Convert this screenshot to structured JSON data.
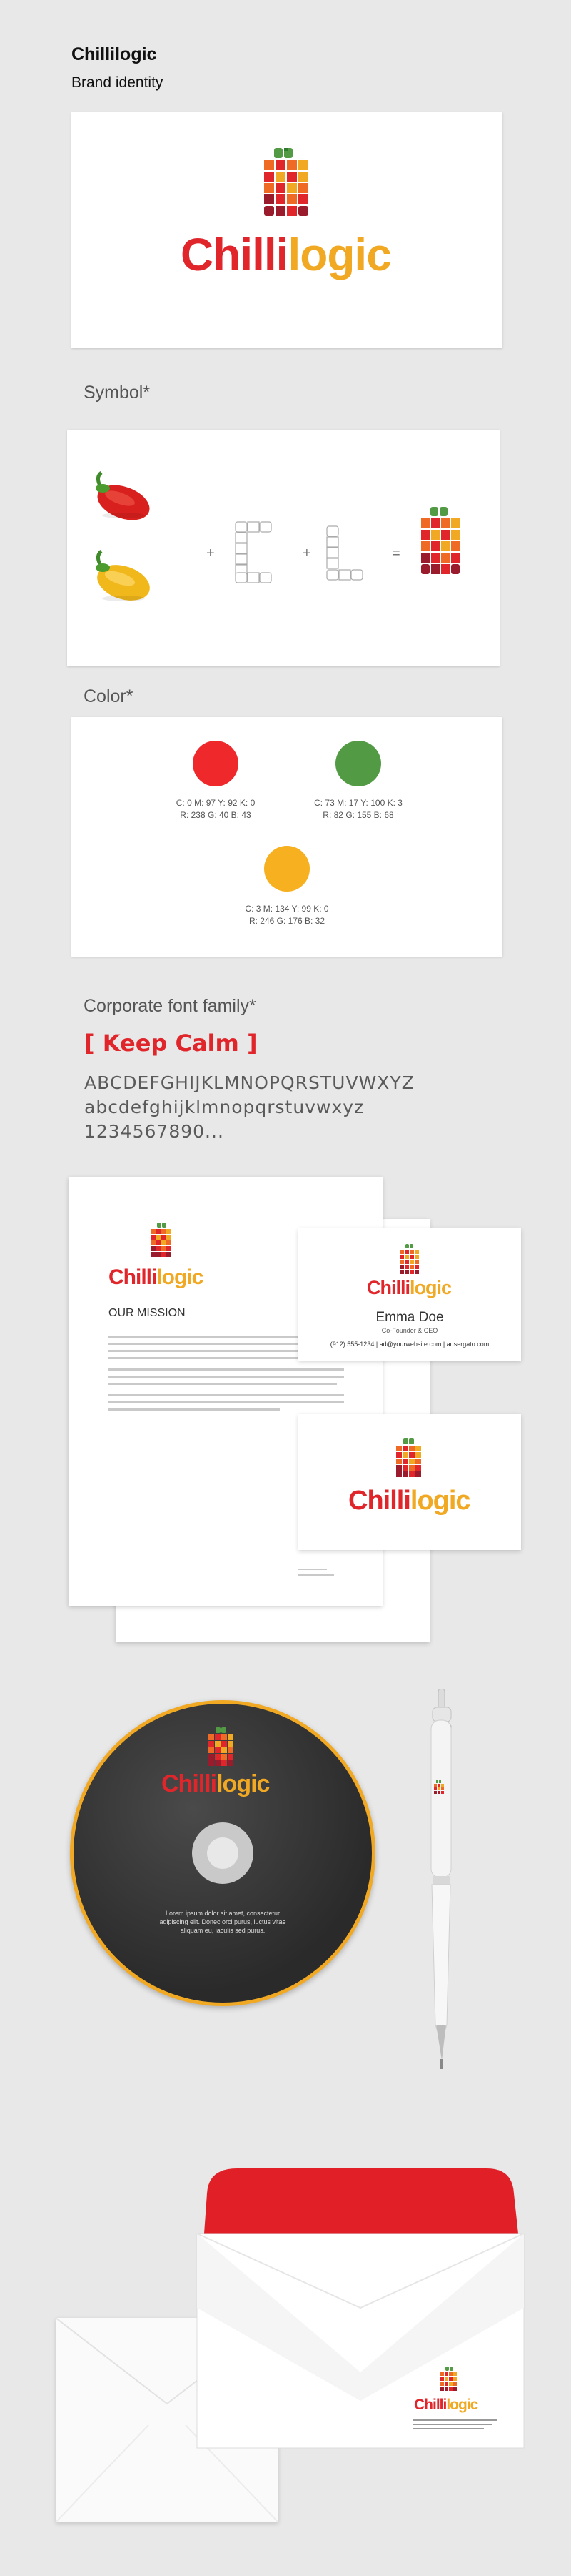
{
  "header": {
    "title": "Chillilogic",
    "subtitle": "Brand identity"
  },
  "logo": {
    "word_part1": "Chilli",
    "word_part2": "logic"
  },
  "symbol": {
    "heading": "Symbol*",
    "plus1": "+",
    "plus2": "+",
    "equals": "="
  },
  "color": {
    "heading": "Color*",
    "swatches": [
      {
        "hex": "#ee282b",
        "cmyk": "C: 0 M: 97 Y: 92 K: 0",
        "rgb": "R: 238 G: 40 B: 43"
      },
      {
        "hex": "#529b44",
        "cmyk": "C: 73 M: 17 Y: 100 K: 3",
        "rgb": "R: 82 G: 155 B: 68"
      },
      {
        "hex": "#f6b020",
        "cmyk": "C: 3 M: 134 Y: 99 K: 0",
        "rgb": "R: 246 G: 176 B: 32"
      }
    ]
  },
  "font": {
    "heading": "Corporate font family*",
    "name": "[ Keep Calm ]",
    "upper": "ABCDEFGHIJKLMNOPQRSTUVWXYZ",
    "lower": "abcdefghijklmnopqrstuvwxyz",
    "digits": "1234567890..."
  },
  "letterhead": {
    "mission": "OUR MISSION"
  },
  "business_card": {
    "name": "Emma Doe",
    "role": "Co-Founder & CEO",
    "contact": "(912) 555-1234 | ad@yourwebsite.com | adsergato.com"
  },
  "cd": {
    "caption": "Lorem ipsum dolor sit amet, consectetur adipiscing elit. Donec orci purus, luctus vitae aliquam eu, iaculis sed purus."
  },
  "colors": {
    "red": "#e0262b",
    "green": "#529b44",
    "yellow": "#f1a924",
    "dark_red": "#9a1b2c",
    "orange": "#ef6a25"
  }
}
